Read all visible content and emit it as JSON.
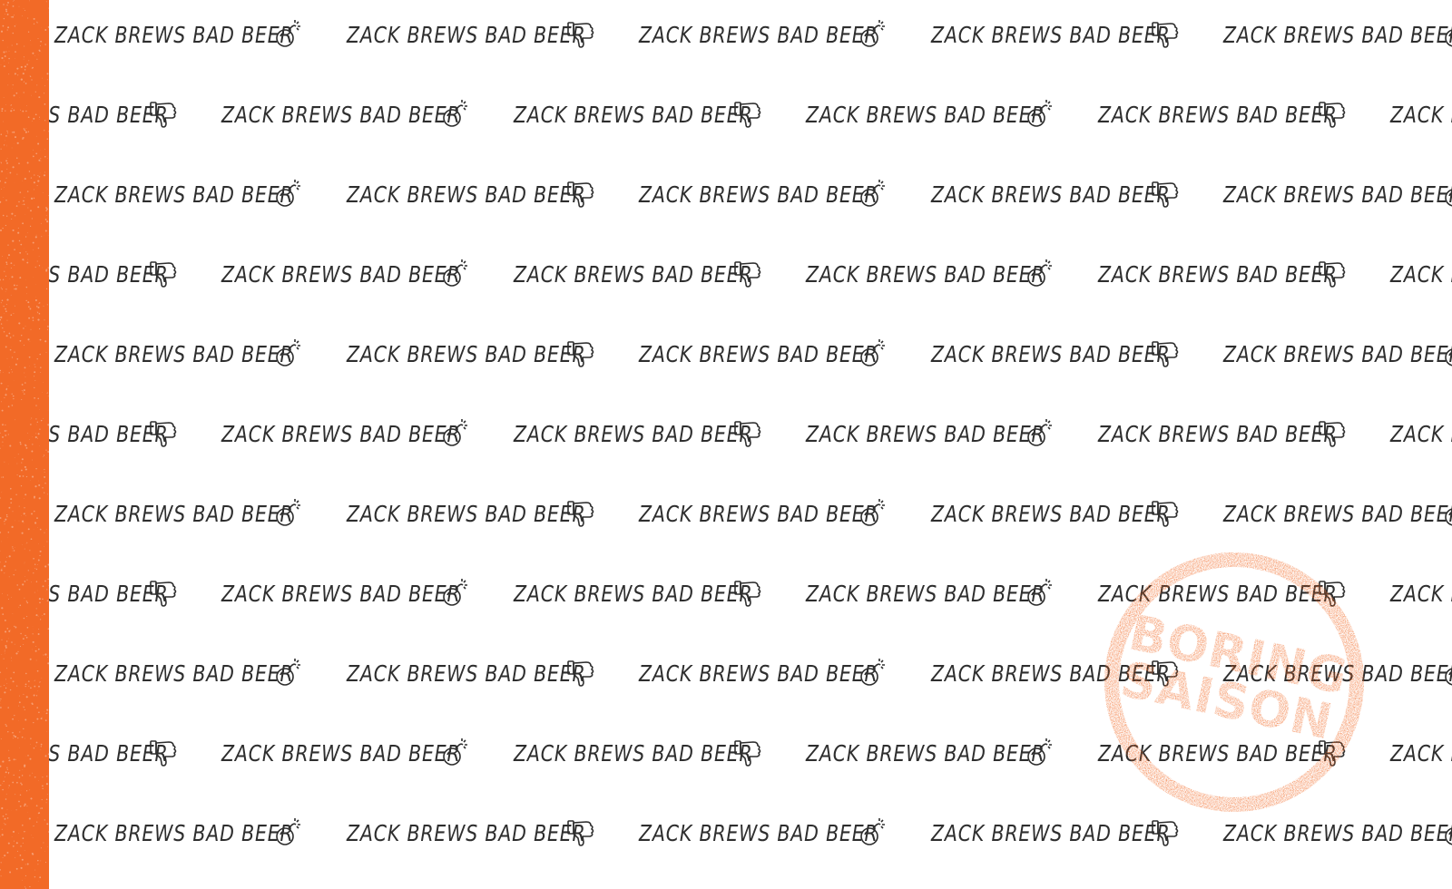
{
  "label": {
    "slogan": "ZACK BREWS BAD BEER",
    "stamp_line1": "BORING",
    "stamp_line2": "SAISON"
  },
  "icons": [
    "thumbs-down-icon",
    "bomb-icon"
  ],
  "colors": {
    "accent": "#f26a27",
    "text": "#2e2e2e",
    "background": "#ffffff"
  }
}
